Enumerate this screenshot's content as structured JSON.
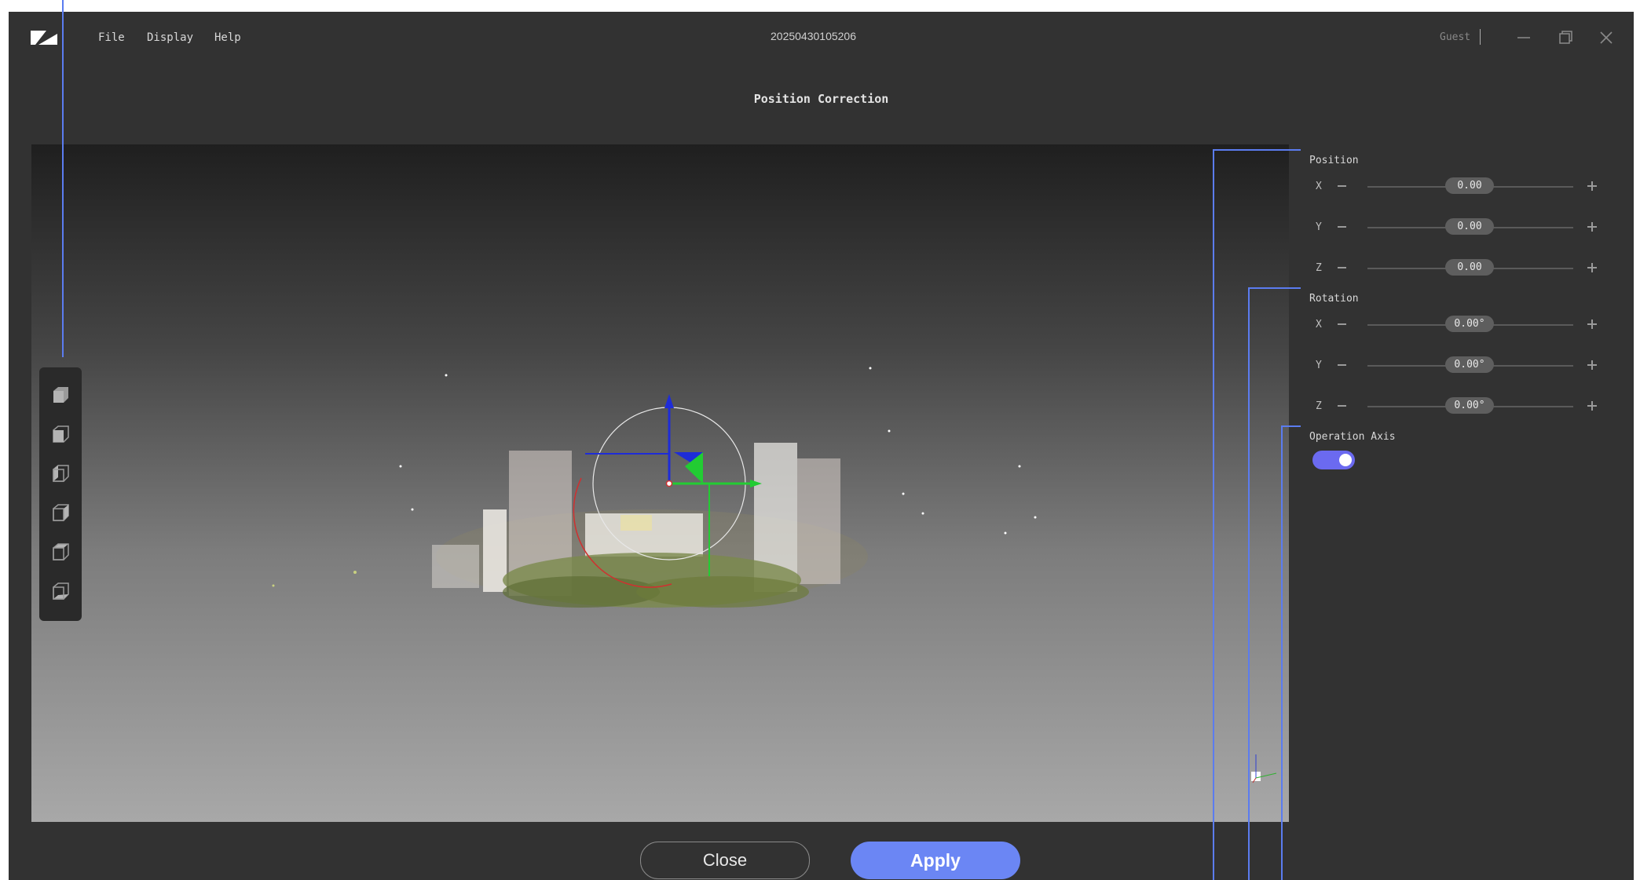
{
  "app": {
    "document_title": "20250430105206",
    "user": "Guest"
  },
  "menu": {
    "items": [
      {
        "label": "File"
      },
      {
        "label": "Display"
      },
      {
        "label": "Help"
      }
    ]
  },
  "dialog": {
    "title": "Position Correction"
  },
  "toolbar": {
    "views": [
      "view-cube-icon",
      "view-front-icon",
      "view-left-icon",
      "view-right-icon",
      "view-top-icon",
      "view-bottom-icon"
    ]
  },
  "position": {
    "label": "Position",
    "rows": [
      {
        "axis": "X",
        "value": "0.00"
      },
      {
        "axis": "Y",
        "value": "0.00"
      },
      {
        "axis": "Z",
        "value": "0.00"
      }
    ]
  },
  "rotation": {
    "label": "Rotation",
    "rows": [
      {
        "axis": "X",
        "value": "0.00°"
      },
      {
        "axis": "Y",
        "value": "0.00°"
      },
      {
        "axis": "Z",
        "value": "0.00°"
      }
    ]
  },
  "operation_axis": {
    "label": "Operation Axis",
    "enabled": true
  },
  "buttons": {
    "close": "Close",
    "apply": "Apply"
  },
  "colors": {
    "accent": "#6b86f4",
    "toggle": "#6b6af0",
    "callout_line": "#5b7cf0"
  }
}
